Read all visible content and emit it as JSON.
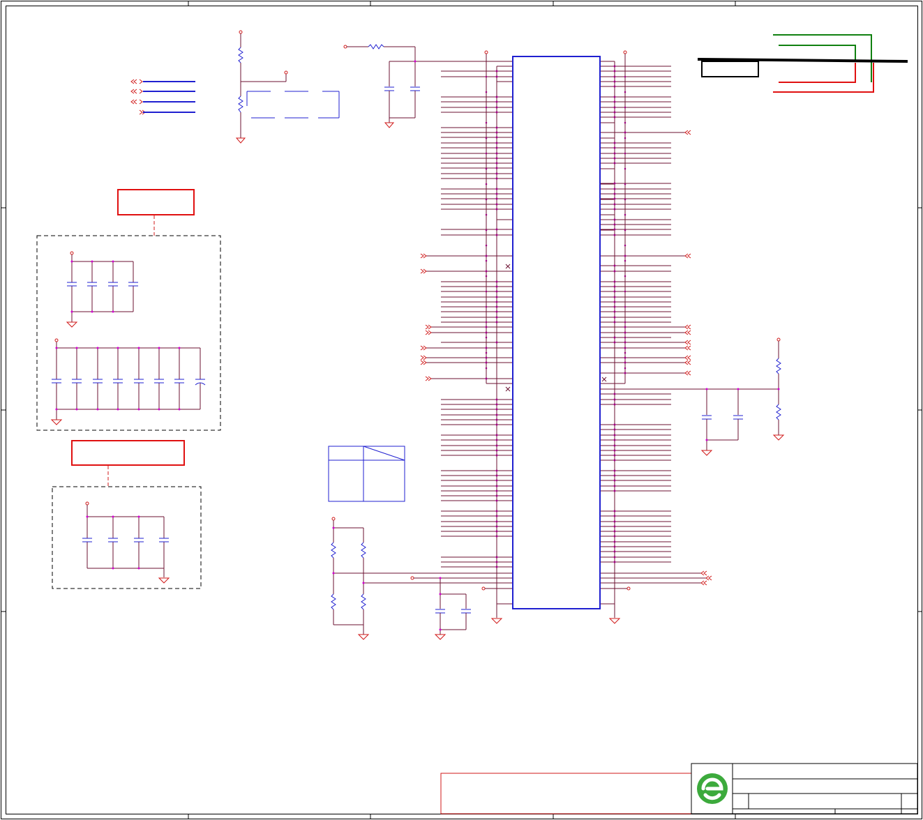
{
  "colors": {
    "frame": "#000000",
    "net": "#6b1030",
    "component": "#1f1fd0",
    "power": "#d01818",
    "junction": "#d000d0",
    "annotation_red": "#e01010",
    "annotation_green": "#108010",
    "logo_green": "#3caa3c",
    "markup_black": "#000000"
  },
  "icons": {
    "logo": "company-logo-icon",
    "ground": "ground-symbol-icon",
    "power": "power-port-icon",
    "offpage": "offpage-connector-icon"
  },
  "sheet": {
    "zone_count_horizontal": 5,
    "zone_count_vertical": 4
  },
  "title_block": {
    "rows": 3
  }
}
